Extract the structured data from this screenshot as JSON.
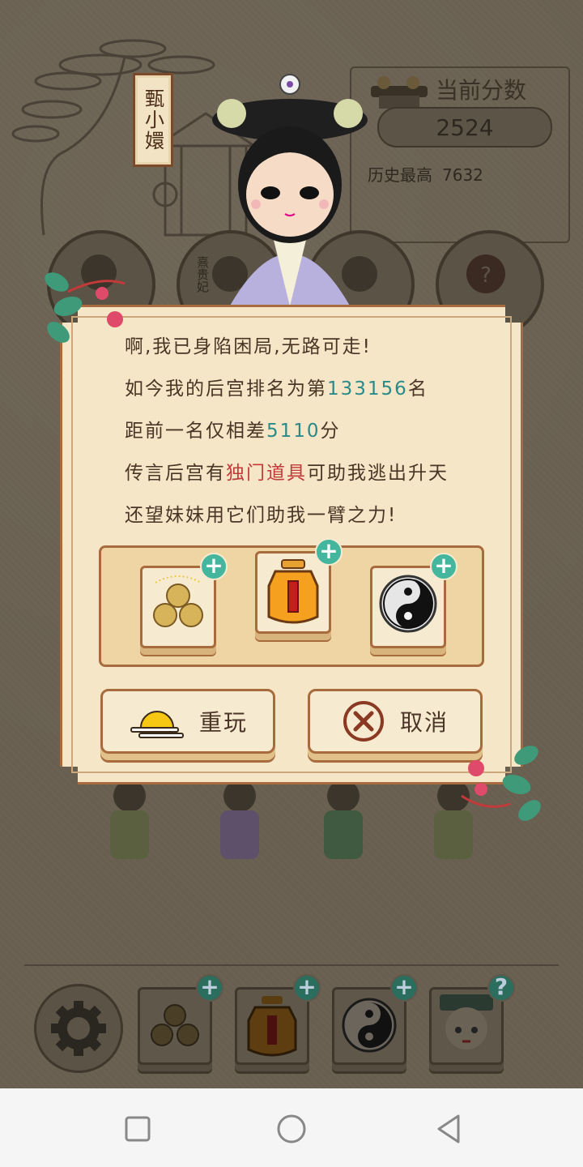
{
  "character": {
    "name": "甄小嬛"
  },
  "score": {
    "title": "当前分数",
    "current": "2524",
    "best_label": "历史最高",
    "best_value": "7632"
  },
  "rank_labels": {
    "second": "熹贵妃"
  },
  "dialog": {
    "line1": "啊,我已身陷困局,无路可走!",
    "line2_prefix": "如今我的后宫排名为第",
    "line2_rank": "133156",
    "line2_suffix": "名",
    "line3_prefix": "距前一名仅相差",
    "line3_diff": "5110",
    "line3_suffix": "分",
    "line4_prefix": "传言后宫有",
    "line4_highlight": "独门道具",
    "line4_suffix": "可助我逃出升天",
    "line5": "还望妹妹用它们助我一臂之力!",
    "replay_label": "重玩",
    "cancel_label": "取消",
    "plus": "+"
  },
  "toolbar": {
    "plus": "+",
    "help": "?"
  },
  "colors": {
    "accent_teal": "#43b69d",
    "rank_number": "#2a8a8a",
    "highlight_red": "#c23a3a",
    "frame_brown": "#a86b3e",
    "paper": "#f4e6c6"
  },
  "icons": [
    "coins-icon",
    "lucky-bag-icon",
    "yin-yang-icon",
    "gear-icon",
    "empress-icon",
    "sunrise-icon",
    "cancel-x-icon",
    "help-icon"
  ]
}
